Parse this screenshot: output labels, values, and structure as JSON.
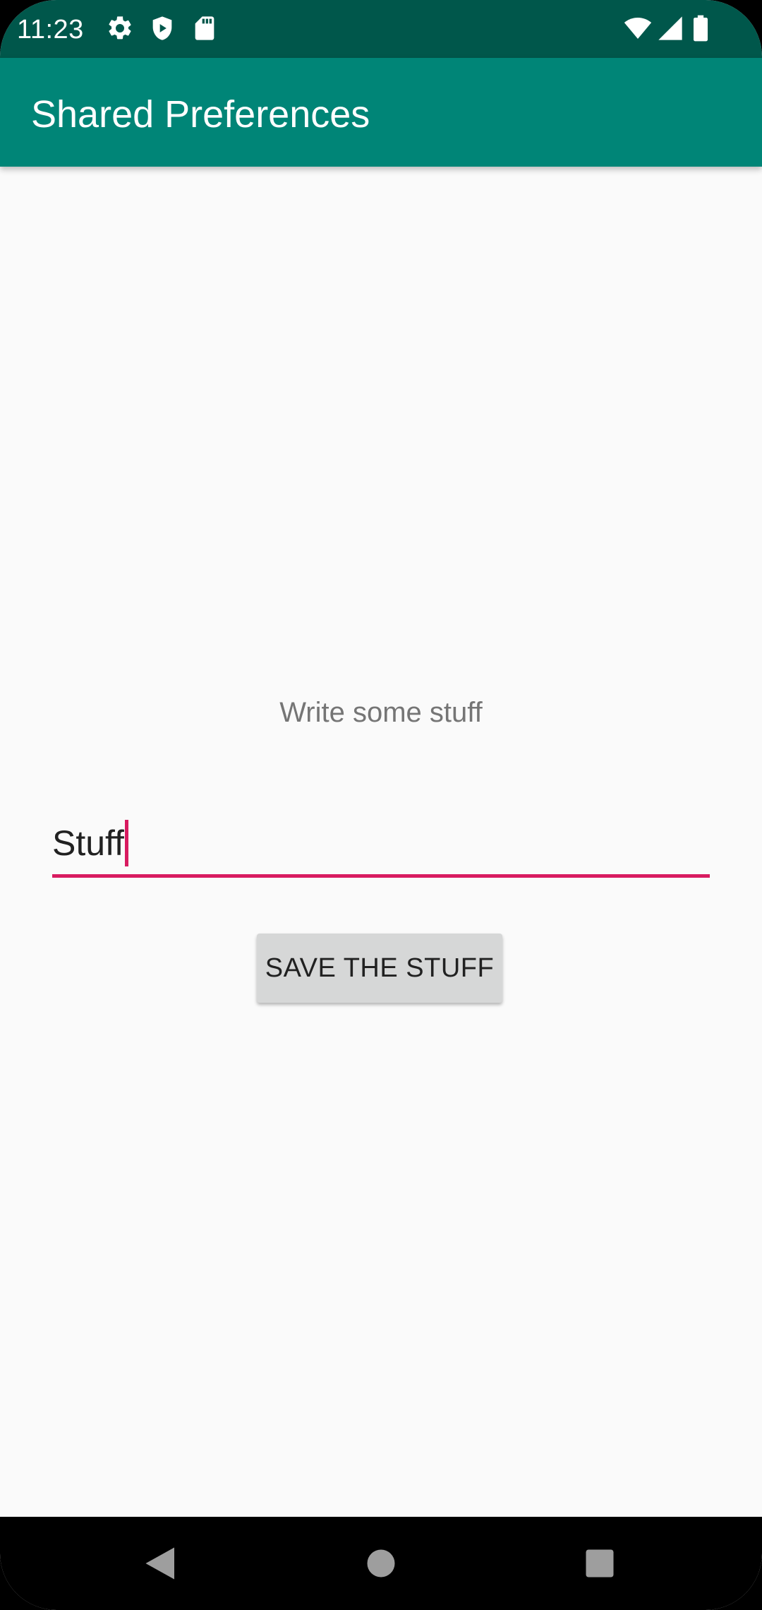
{
  "status_bar": {
    "time": "11:23",
    "left_icons": [
      "settings-icon",
      "shield-play-icon",
      "sd-card-icon"
    ],
    "right_icons": [
      "wifi-icon",
      "cell-signal-icon",
      "battery-icon"
    ],
    "background_color": "#00574b"
  },
  "app_bar": {
    "title": "Shared Preferences",
    "background_color": "#008577"
  },
  "main": {
    "prompt_label": "Write some stuff",
    "input_value": "Stuff",
    "save_button_label": "SAVE THE STUFF",
    "accent_color": "#d81b60"
  },
  "nav_bar": {
    "buttons": [
      "back-icon",
      "home-icon",
      "recents-icon"
    ]
  }
}
